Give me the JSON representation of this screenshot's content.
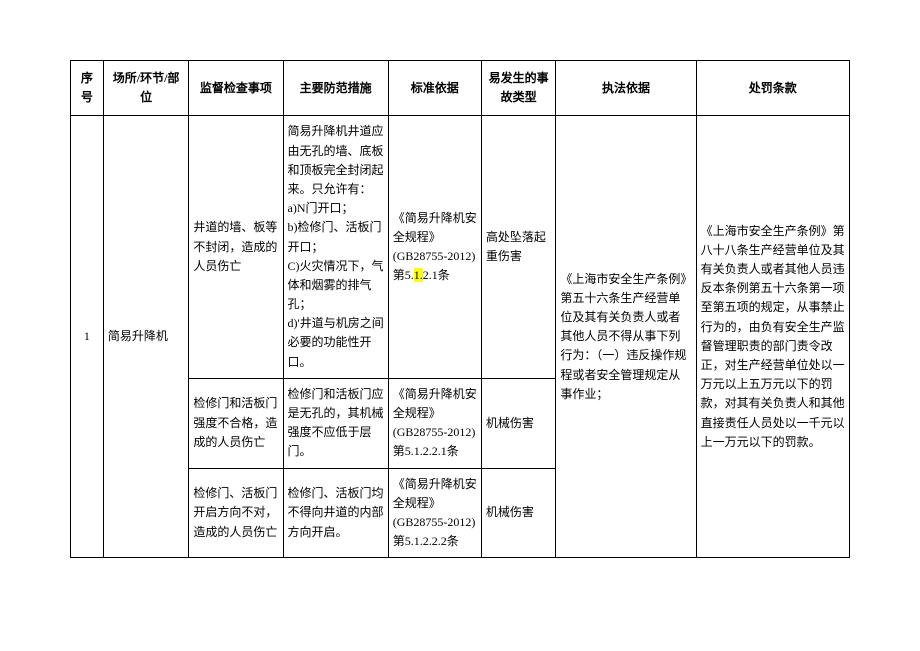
{
  "headers": {
    "seq": "序号",
    "place": "场所/环节/部位",
    "inspect": "监督检查事项",
    "measure": "主要防范措施",
    "standard": "标准依据",
    "accident": "易发生的事故类型",
    "law": "执法依据",
    "penalty": "处罚条款"
  },
  "rows": {
    "seq": "1",
    "place": "简易升降机",
    "law": "《上海市安全生产条例》第五十六条生产经营单位及其有关负责人或者其他人员不得从事下列行为：（一）违反操作规程或者安全管理规定从事作业；",
    "penalty": "《上海市安全生产条例》第八十八条生产经营单位及其有关负责人或者其他人员违反本条例第五十六条第一项至第五项的规定，从事禁止行为的，由负有安全生产监督管理职责的部门责令改正，对生产经营单位处以一万元以上五万元以下的罚款，对其有关负责人和其他直接责任人员处以一千元以上一万元以下的罚款。",
    "r1": {
      "inspect": "井道的墙、板等不封闭，造成的人员伤亡",
      "measure": "简易升降机井道应由无孔的墙、底板和顶板完全封闭起来。只允许有：\na)N门开口；\nb)检修门、活板门开口；\nC)火灾情况下，气体和烟雾的排气孔；\nd)'井道与机房之间必要的功能性开口。",
      "standard_title": "《简易升降机安全规程》",
      "standard_code": "(GB28755-2012)第5.",
      "standard_hl": "1.",
      "standard_tail": "2.1条",
      "accident": "高处坠落起重伤害"
    },
    "r2": {
      "inspect": "检修门和活板门强度不合格，造成的人员伤亡",
      "measure": "检修门和活板门应是无孔的，其机械强度不应低于层门。",
      "standard": "《简易升降机安全规程》(GB28755-2012)第5.1.2.2.1条",
      "accident": "机械伤害"
    },
    "r3": {
      "inspect": "检修门、活板门开启方向不对，造成的人员伤亡",
      "measure": "检修门、活板门均不得向井道的内部方向开启。",
      "standard": "《简易升降机安全规程》(GB28755-2012)第5.1.2.2.2条",
      "accident": "机械伤害"
    }
  }
}
